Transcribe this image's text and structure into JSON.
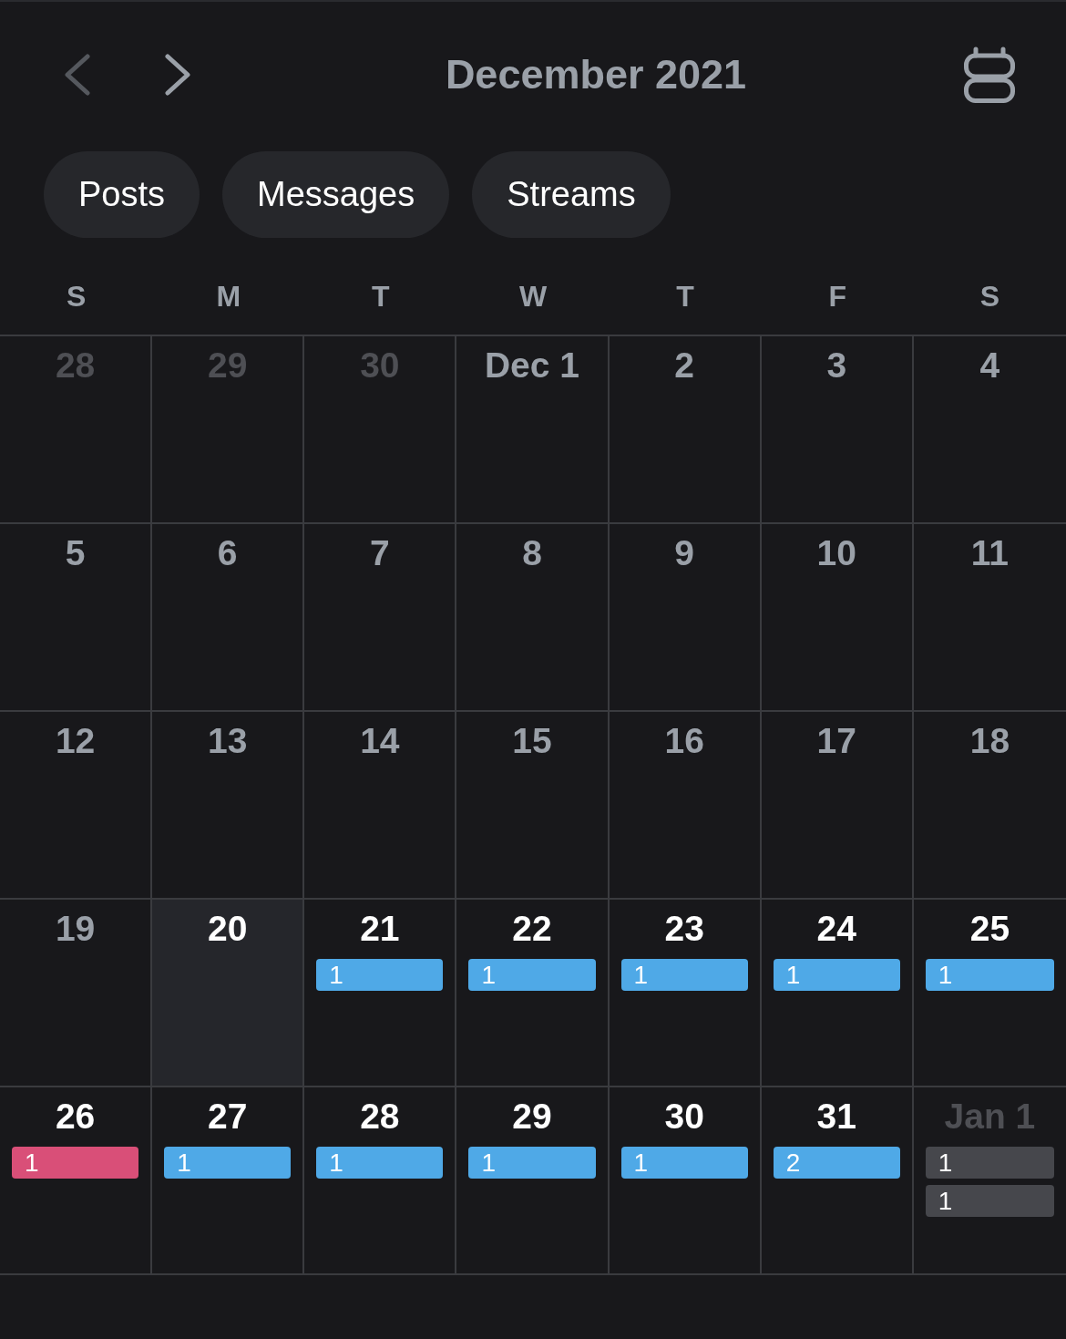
{
  "header": {
    "prev_button": {
      "disabled": true
    },
    "title": "December 2021",
    "next_button": {
      "disabled": false
    }
  },
  "filters": [
    {
      "label": "Posts",
      "selected": false
    },
    {
      "label": "Messages",
      "selected": false
    },
    {
      "label": "Streams",
      "selected": false
    }
  ],
  "weekdays": [
    "S",
    "M",
    "T",
    "W",
    "T",
    "F",
    "S"
  ],
  "weeks": [
    {
      "days": [
        {
          "label": "28",
          "kind": "other"
        },
        {
          "label": "29",
          "kind": "other"
        },
        {
          "label": "30",
          "kind": "other"
        },
        {
          "label": "Dec 1",
          "kind": "past"
        },
        {
          "label": "2",
          "kind": "past"
        },
        {
          "label": "3",
          "kind": "past"
        },
        {
          "label": "4",
          "kind": "past"
        }
      ]
    },
    {
      "days": [
        {
          "label": "5",
          "kind": "past"
        },
        {
          "label": "6",
          "kind": "past"
        },
        {
          "label": "7",
          "kind": "past"
        },
        {
          "label": "8",
          "kind": "past"
        },
        {
          "label": "9",
          "kind": "past"
        },
        {
          "label": "10",
          "kind": "past"
        },
        {
          "label": "11",
          "kind": "past"
        }
      ]
    },
    {
      "days": [
        {
          "label": "12",
          "kind": "past"
        },
        {
          "label": "13",
          "kind": "past"
        },
        {
          "label": "14",
          "kind": "past"
        },
        {
          "label": "15",
          "kind": "past"
        },
        {
          "label": "16",
          "kind": "past"
        },
        {
          "label": "17",
          "kind": "past"
        },
        {
          "label": "18",
          "kind": "past"
        }
      ]
    },
    {
      "days": [
        {
          "label": "19",
          "kind": "past"
        },
        {
          "label": "20",
          "kind": "today"
        },
        {
          "label": "21",
          "kind": "upcoming",
          "events": [
            {
              "count": "1",
              "color": "#4fa9e7"
            }
          ]
        },
        {
          "label": "22",
          "kind": "upcoming",
          "events": [
            {
              "count": "1",
              "color": "#4fa9e7"
            }
          ]
        },
        {
          "label": "23",
          "kind": "upcoming",
          "events": [
            {
              "count": "1",
              "color": "#4fa9e7"
            }
          ]
        },
        {
          "label": "24",
          "kind": "upcoming",
          "events": [
            {
              "count": "1",
              "color": "#4fa9e7"
            }
          ]
        },
        {
          "label": "25",
          "kind": "upcoming",
          "events": [
            {
              "count": "1",
              "color": "#4fa9e7"
            }
          ]
        }
      ]
    },
    {
      "days": [
        {
          "label": "26",
          "kind": "upcoming",
          "events": [
            {
              "count": "1",
              "color": "#d94f78"
            }
          ]
        },
        {
          "label": "27",
          "kind": "upcoming",
          "events": [
            {
              "count": "1",
              "color": "#4fa9e7"
            }
          ]
        },
        {
          "label": "28",
          "kind": "upcoming",
          "events": [
            {
              "count": "1",
              "color": "#4fa9e7"
            }
          ]
        },
        {
          "label": "29",
          "kind": "upcoming",
          "events": [
            {
              "count": "1",
              "color": "#4fa9e7"
            }
          ]
        },
        {
          "label": "30",
          "kind": "upcoming",
          "events": [
            {
              "count": "1",
              "color": "#4fa9e7"
            }
          ]
        },
        {
          "label": "31",
          "kind": "upcoming",
          "events": [
            {
              "count": "2",
              "color": "#4fa9e7"
            }
          ]
        },
        {
          "label": "Jan 1",
          "kind": "other",
          "events": [
            {
              "count": "1",
              "color": "#46474c"
            },
            {
              "count": "1",
              "color": "#46474c"
            }
          ]
        }
      ]
    }
  ]
}
